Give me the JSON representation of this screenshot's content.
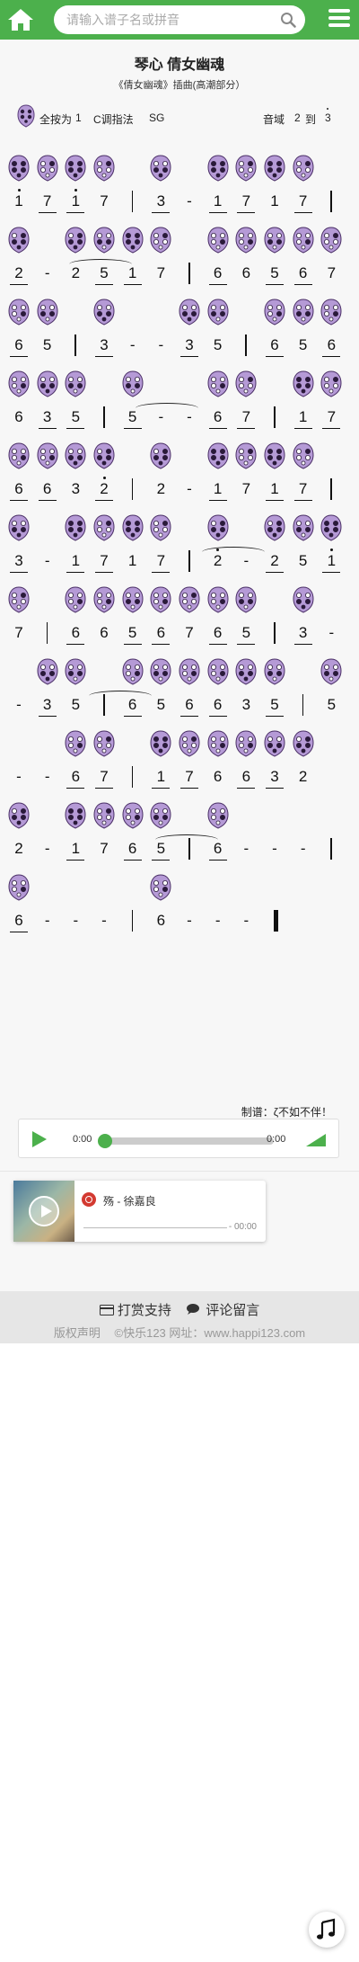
{
  "search": {
    "placeholder": "请输入谱子名或拼音"
  },
  "song": {
    "title": "琴心 倩女幽魂",
    "subtitle": "《倩女幽魂》插曲(高潮部分）"
  },
  "info": {
    "all_press": "全按为",
    "all_press_value": "1",
    "fingering": "C调指法",
    "fingering_suffix": "SG",
    "range_label": "音域",
    "range_low": "2",
    "range_to": "到",
    "range_high": "3"
  },
  "score": {
    "lines": [
      [
        "1",
        "7",
        "1",
        "7",
        "|",
        "3",
        "-",
        "1",
        "7",
        "1",
        "7",
        "|"
      ],
      [
        "2",
        "-",
        "2",
        "5",
        "1",
        "7",
        "|",
        "6",
        "6",
        "5",
        "6",
        "7"
      ],
      [
        "6",
        "5",
        "|",
        "3",
        "-",
        "-",
        "3",
        "5",
        "|",
        "6",
        "5",
        "6"
      ],
      [
        "6",
        "3",
        "5",
        "|",
        "5",
        "-",
        "-",
        "6",
        "7",
        "|",
        "1",
        "7"
      ],
      [
        "6",
        "6",
        "3",
        "2",
        "|",
        "2",
        "-",
        "1",
        "7",
        "1",
        "7",
        "|"
      ],
      [
        "3",
        "-",
        "1",
        "7",
        "1",
        "7",
        "|",
        "2",
        "-",
        "2",
        "5",
        "1"
      ],
      [
        "7",
        "|",
        "6",
        "6",
        "5",
        "6",
        "7",
        "6",
        "5",
        "|",
        "3",
        "-"
      ],
      [
        "-",
        "3",
        "5",
        "|",
        "6",
        "5",
        "6",
        "6",
        "3",
        "5",
        "|",
        "5"
      ],
      [
        "-",
        "-",
        "6",
        "7",
        "|",
        "1",
        "7",
        "6",
        "6",
        "3",
        "2"
      ],
      [
        "2",
        "-",
        "1",
        "7",
        "6",
        "5",
        "|",
        "6",
        "-",
        "-",
        "-",
        "|"
      ],
      [
        "6",
        "-",
        "-",
        "-",
        "|",
        "6",
        "-",
        "-",
        "-",
        "‖"
      ]
    ]
  },
  "maker": "制谱：ζ不如不伴！",
  "player": {
    "current_time": "0:00",
    "duration": "0:00",
    "progress": 0
  },
  "mini_player": {
    "song": "殇 - 徐嘉良",
    "time": "- 00:00"
  },
  "footer": {
    "donate": "打赏支持",
    "comment": "评论留言",
    "copyright": "版权声明",
    "site": "©快乐123 网址：www.happi123.com"
  },
  "colors": {
    "brand_green": "#4cb04c",
    "ocarina_purple": "#b59ad6"
  }
}
